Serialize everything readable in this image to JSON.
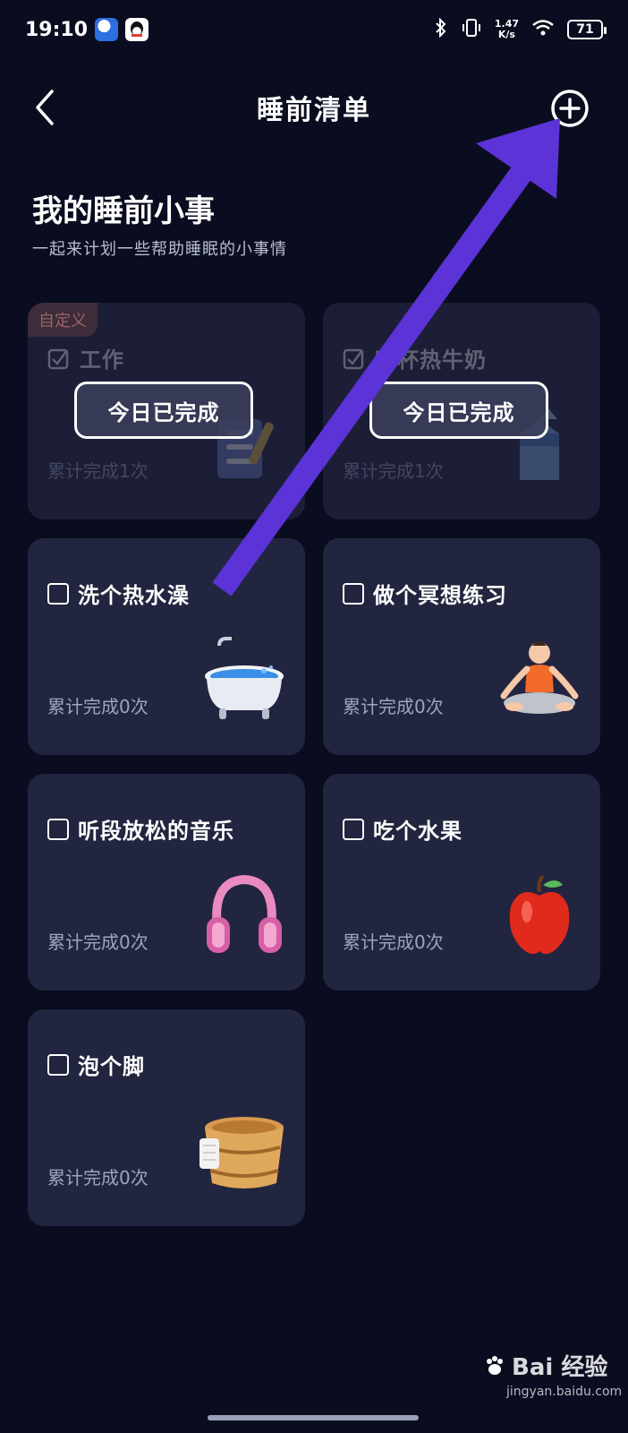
{
  "status_bar": {
    "time": "19:10",
    "net_speed_value": "1.47",
    "net_speed_unit": "K/s",
    "battery": "71"
  },
  "header": {
    "title": "睡前清单"
  },
  "intro": {
    "headline": "我的睡前小事",
    "subheadline": "一起来计划一些帮助睡眠的小事情"
  },
  "cards": [
    {
      "title": "工作",
      "tag": "自定义",
      "count": "累计完成1次",
      "done_label": "今日已完成",
      "illustration": "checklist-illustration"
    },
    {
      "title": "喝杯热牛奶",
      "count": "累计完成1次",
      "done_label": "今日已完成",
      "illustration": "milk-carton-illustration"
    },
    {
      "title": "洗个热水澡",
      "count": "累计完成0次",
      "illustration": "bathtub-illustration"
    },
    {
      "title": "做个冥想练习",
      "count": "累计完成0次",
      "illustration": "meditation-illustration"
    },
    {
      "title": "听段放松的音乐",
      "count": "累计完成0次",
      "illustration": "headphones-illustration"
    },
    {
      "title": "吃个水果",
      "count": "累计完成0次",
      "illustration": "apple-illustration"
    },
    {
      "title": "泡个脚",
      "count": "累计完成0次",
      "illustration": "foot-tub-illustration"
    }
  ],
  "watermark": {
    "brand": "Bai 经验",
    "url": "jingyan.baidu.com"
  },
  "colors": {
    "background": "#0a0d1f",
    "card": "#22253f",
    "annotation_arrow": "#5b33d6"
  }
}
